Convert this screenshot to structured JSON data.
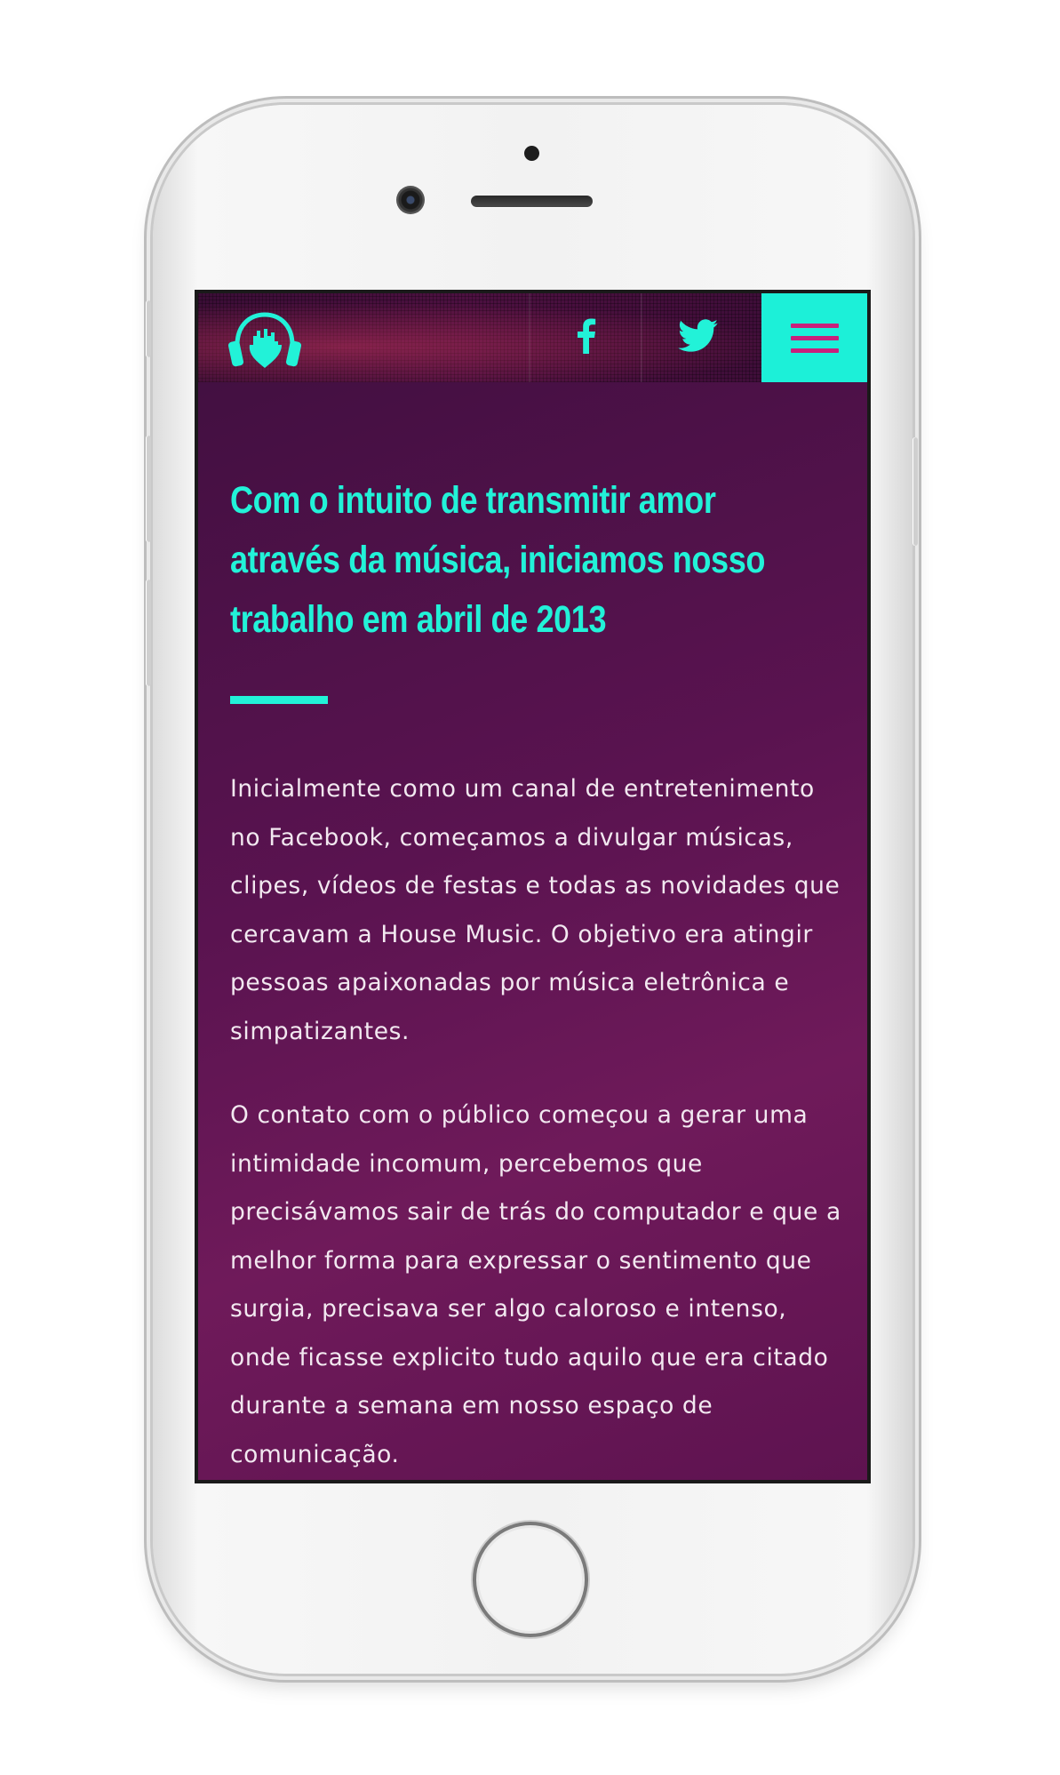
{
  "header": {
    "logo_icon": "headphones-heart-equalizer-icon",
    "social": [
      {
        "name": "facebook",
        "icon": "facebook-icon",
        "label": "f"
      },
      {
        "name": "twitter",
        "icon": "twitter-bird-icon"
      }
    ],
    "menu_icon": "hamburger-menu-icon"
  },
  "main": {
    "headline": "Com o intuito de transmitir amor através da música, iniciamos nosso trabalho em abril de 2013",
    "paragraphs": [
      "Inicialmente como um canal de entretenimento no Facebook, começamos a divulgar músicas, clipes, vídeos de festas e todas as novidades que cercavam a House Music. O objetivo era atingir pessoas apaixonadas por música eletrônica e simpatizantes.",
      "O contato com o público começou a gerar uma intimidade incomum, percebemos que precisávamos sair de trás do computador e que a melhor forma para expressar o sentimento que surgia, precisava ser algo caloroso e intenso, onde ficasse explicito tudo aquilo que era citado durante a semana em nosso espaço de comunicação."
    ]
  },
  "colors": {
    "accent": "#22f2d8",
    "menu_bar": "#c9207c",
    "background": "#5a1350",
    "body_text": "#f2e8f0"
  }
}
